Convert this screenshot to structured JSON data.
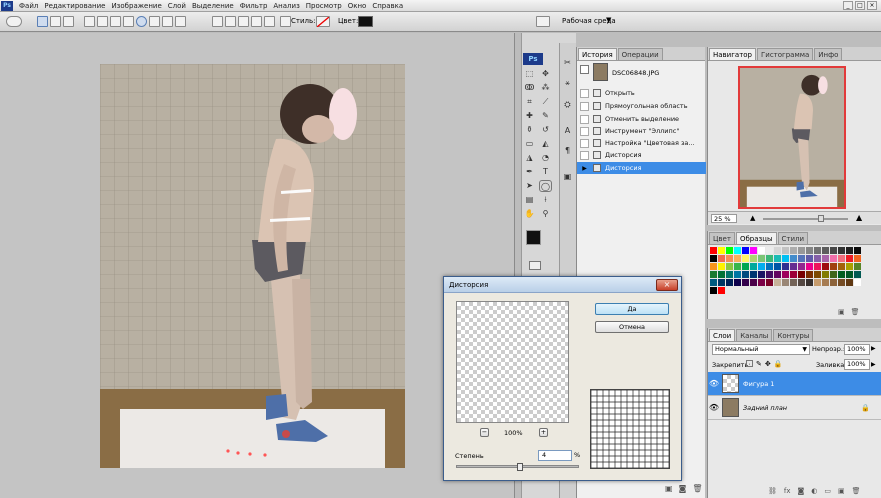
{
  "app": {
    "logo": "Ps"
  },
  "menu": [
    "Файл",
    "Редактирование",
    "Изображение",
    "Слой",
    "Выделение",
    "Фильтр",
    "Анализ",
    "Просмотр",
    "Окно",
    "Справка"
  ],
  "options_bar": {
    "style_label": "Стиль:",
    "color_label": "Цвет:",
    "color_value": "#111111",
    "workspace_label": "Рабочая среда"
  },
  "history_panel": {
    "tabs": [
      "История",
      "Операции"
    ],
    "document": "DSC06848.JPG",
    "steps": [
      "Открыть",
      "Прямоугольная область",
      "Отменить выделение",
      "Инструмент \"Эллипс\"",
      "Настройка \"Цветовая за...",
      "Дисторсия",
      "Дисторсия"
    ],
    "selected_step": 6
  },
  "navigator_panel": {
    "tabs": [
      "Навигатор",
      "Гистограмма",
      "Инфо"
    ],
    "zoom": "25 %"
  },
  "swatches_panel": {
    "tabs": [
      "Цвет",
      "Образцы",
      "Стили"
    ],
    "colors": [
      "#ff0000",
      "#ffff00",
      "#00ff00",
      "#00ffff",
      "#0000ff",
      "#ff00ff",
      "#ffffff",
      "#ebebeb",
      "#d6d6d6",
      "#c2c2c2",
      "#adadad",
      "#999999",
      "#858585",
      "#707070",
      "#5c5c5c",
      "#474747",
      "#333333",
      "#1f1f1f",
      "#0a0a0a",
      "#000000",
      "#f26c4f",
      "#f68e55",
      "#fbaf5c",
      "#fff467",
      "#acd372",
      "#7cc576",
      "#3bb878",
      "#1abbb4",
      "#00bff3",
      "#438ccb",
      "#5574b9",
      "#605ca8",
      "#855fa8",
      "#a763a8",
      "#f06ea9",
      "#f26d7d",
      "#ed1c24",
      "#f26522",
      "#f7941d",
      "#fff200",
      "#8dc63f",
      "#39b54a",
      "#00a651",
      "#00a99d",
      "#00aeef",
      "#0072bc",
      "#0054a6",
      "#2e3192",
      "#662d91",
      "#92278f",
      "#ec008c",
      "#ed145b",
      "#9e0b0f",
      "#a0410d",
      "#a3620a",
      "#aba000",
      "#598527",
      "#1a7b30",
      "#007236",
      "#00746b",
      "#0076a3",
      "#004b80",
      "#003471",
      "#1b1464",
      "#440e62",
      "#630460",
      "#9e005d",
      "#9e0039",
      "#790000",
      "#7b2e00",
      "#7d4900",
      "#827b00",
      "#406618",
      "#005e20",
      "#005826",
      "#005952",
      "#005b7f",
      "#003663",
      "#002157",
      "#0d004c",
      "#32004b",
      "#4b0049",
      "#7b0046",
      "#7a0026",
      "#c7b299",
      "#998675",
      "#736357",
      "#534741",
      "#37302d",
      "#c69c6d",
      "#a67c52",
      "#8c6239",
      "#754c24",
      "#603913",
      "#ffffff",
      "#000000",
      "#ff0000"
    ]
  },
  "layers_panel": {
    "tabs": [
      "Слои",
      "Каналы",
      "Контуры"
    ],
    "blend_mode": "Нормальный",
    "opacity_label": "Непрозр.:",
    "opacity": "100%",
    "lock_label": "Закрепить:",
    "fill_label": "Заливка:",
    "fill": "100%",
    "layers": [
      {
        "name": "Фигура 1",
        "selected": true
      },
      {
        "name": "Задний план",
        "selected": false
      }
    ]
  },
  "dialog": {
    "title": "Дисторсия",
    "ok": "Да",
    "cancel": "Отмена",
    "zoom": "100%",
    "zoom_minus": "−",
    "zoom_plus": "+",
    "degree_label": "Степень",
    "degree_value": "4",
    "degree_unit": "%",
    "degree_level_percent": 52
  }
}
